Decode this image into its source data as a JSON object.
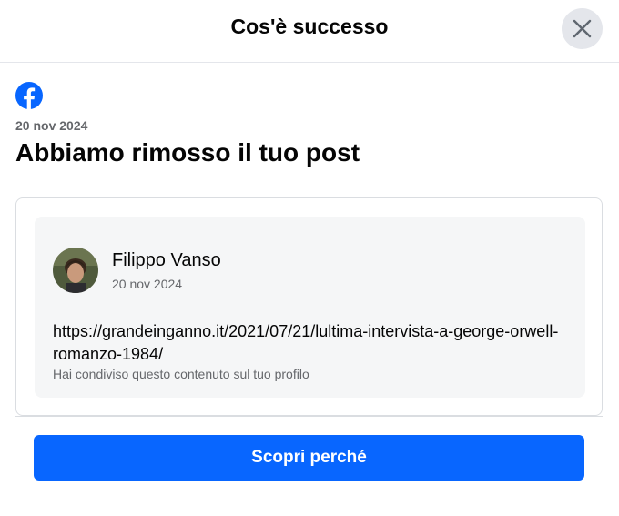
{
  "dialog": {
    "title": "Cos'è successo",
    "close_icon": "close-icon"
  },
  "notice": {
    "logo_icon": "facebook-logo-icon",
    "brand_color": "#0866ff",
    "date": "20 nov 2024",
    "title": "Abbiamo rimosso il tuo post"
  },
  "post": {
    "author_name": "Filippo Vanso",
    "date": "20 nov 2024",
    "link": "https://grandeinganno.it/2021/07/21/lultima-intervista-a-george-orwell-romanzo-1984/",
    "shared_note": "Hai condiviso questo contenuto sul tuo profilo"
  },
  "actions": {
    "primary_label": "Scopri perché"
  }
}
